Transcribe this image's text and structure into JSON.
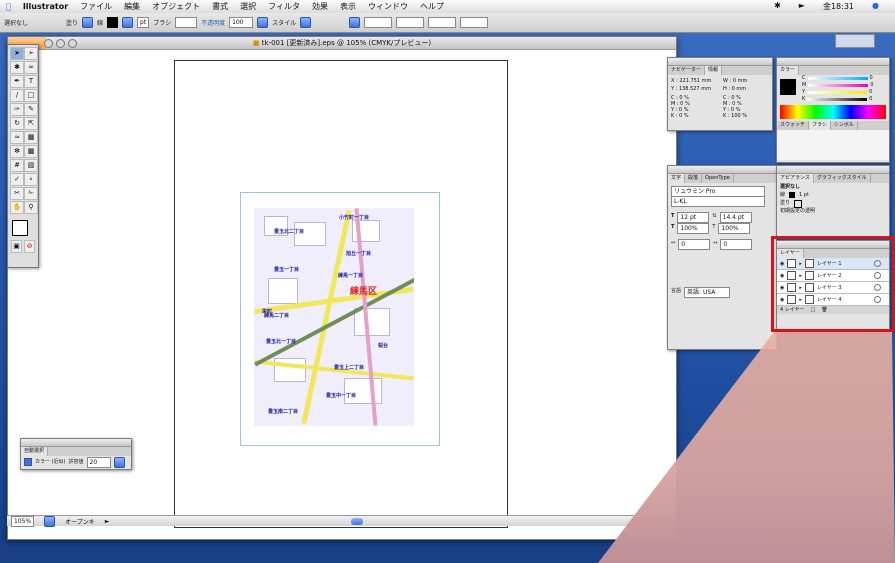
{
  "menubar": {
    "app_name": "Illustrator",
    "items": [
      "ファイル",
      "編集",
      "オブジェクト",
      "書式",
      "選択",
      "フィルタ",
      "効果",
      "表示",
      "ウィンドウ",
      "ヘルプ"
    ],
    "clock": "金18:31"
  },
  "controlbar": {
    "selection_label": "選択なし",
    "fill_label": "塗り",
    "stroke_label": "線",
    "stroke_weight": "pt",
    "brush_label": "ブラシ",
    "opacity_label": "不透明度",
    "opacity_value": "100",
    "style_label": "スタイル"
  },
  "document": {
    "title": "tk-001 [更新済み].eps @ 105% (CMYK/プレビュー)",
    "zoom": "105%",
    "status_text": "オープンキ"
  },
  "map": {
    "district": "練馬区",
    "labels": [
      "豊玉北二丁目",
      "小竹町一丁目",
      "旭丘一丁目",
      "豊玉一丁目",
      "栄町",
      "練馬一丁目",
      "練馬二丁目",
      "豊玉上二丁目",
      "豊玉中一丁目",
      "豊玉南二丁目",
      "豊玉北一丁目",
      "桜台"
    ]
  },
  "info_panel": {
    "tabs": [
      "ナビゲーター",
      "情報"
    ],
    "x_label": "X",
    "x_value": "221.751 mm",
    "y_label": "Y",
    "y_value": "138.527 mm",
    "w_label": "W",
    "w_value": "0 mm",
    "h_label": "H",
    "h_value": "0 mm",
    "cmyk_left": [
      "C : 0 %",
      "M : 0 %",
      "Y : 0 %",
      "K : 0 %"
    ],
    "cmyk_right": [
      "C : 0 %",
      "M : 0 %",
      "Y : 0 %",
      "K : 100 %"
    ]
  },
  "color_panel": {
    "tabs": [
      "カラー"
    ],
    "channels": [
      "C",
      "M",
      "Y",
      "K"
    ],
    "values": [
      "0",
      "0",
      "0",
      "0"
    ],
    "bottom_tabs": [
      "スウォッチ",
      "ブラシ",
      "シンボル"
    ]
  },
  "char_panel": {
    "tabs": [
      "文字",
      "段落",
      "OpenType"
    ],
    "font_name": "リュウミン Pro",
    "font_style": "L-KL",
    "size": "12 pt",
    "leading": "14.4 pt",
    "scale_v": "100%",
    "scale_h": "100%",
    "tracking": "0",
    "kerning": "0",
    "lang_label": "言語",
    "lang_value": "英語: USA"
  },
  "appearance_panel": {
    "tabs": [
      "アピアランス",
      "グラフィックスタイル"
    ],
    "item": "選択なし",
    "stroke_label": "線",
    "stroke_value": "1 pt",
    "fill_label": "塗り",
    "opacity_label": "初期設定の透明"
  },
  "layers_panel": {
    "tab": "レイヤー",
    "layers": [
      "レイヤー 1",
      "レイヤー 2",
      "レイヤー 3",
      "レイヤー 4"
    ],
    "footer": "4 レイヤー"
  },
  "small_panel": {
    "tab": "自動選択",
    "checkbox_label": "カラー (近似)",
    "tolerance_label": "許容値",
    "tolerance_value": "20"
  },
  "colors": {
    "accent": "#d8121a",
    "desktop": "#2a5cb2"
  }
}
